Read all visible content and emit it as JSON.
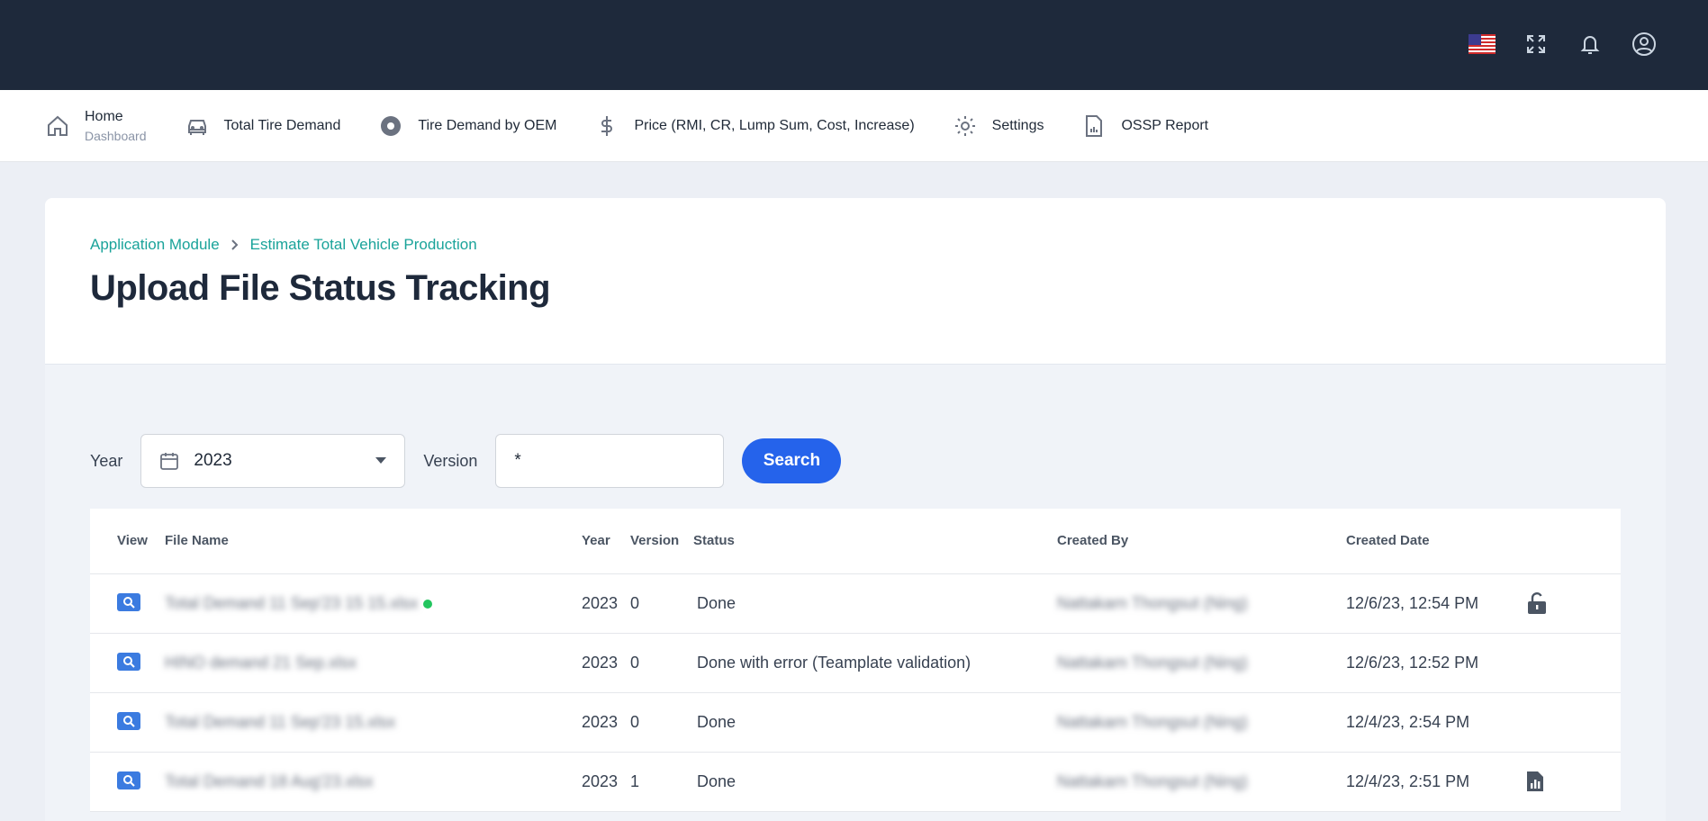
{
  "nav": {
    "items": [
      {
        "label": "Home",
        "sub": "Dashboard"
      },
      {
        "label": "Total Tire Demand"
      },
      {
        "label": "Tire Demand by OEM"
      },
      {
        "label": "Price (RMI, CR, Lump Sum, Cost, Increase)"
      },
      {
        "label": "Settings"
      },
      {
        "label": "OSSP Report"
      }
    ]
  },
  "breadcrumb": [
    "Application Module",
    "Estimate Total Vehicle Production"
  ],
  "page_title": "Upload File Status Tracking",
  "filters": {
    "year_label": "Year",
    "year_value": "2023",
    "version_label": "Version",
    "version_value": "*",
    "search_label": "Search"
  },
  "table": {
    "headers": [
      "View",
      "File Name",
      "Year",
      "Version",
      "Status",
      "Created By",
      "Created Date"
    ],
    "rows": [
      {
        "file": "Total Demand 11 Sep'23 15 15.xlsx",
        "year": "2023",
        "version": "0",
        "status": "Done",
        "created_by": "Nattakarn Thongsut (Ning)",
        "date": "12/6/23, 12:54 PM",
        "action": "unlock-icon"
      },
      {
        "file": "HINO demand 21 Sep.xlsx",
        "year": "2023",
        "version": "0",
        "status": "Done with error (Teamplate validation)",
        "created_by": "Nattakarn Thongsut (Ning)",
        "date": "12/6/23, 12:52 PM",
        "action": ""
      },
      {
        "file": "Total Demand 11 Sep'23 15.xlsx",
        "year": "2023",
        "version": "0",
        "status": "Done",
        "created_by": "Nattakarn Thongsut (Ning)",
        "date": "12/4/23, 2:54 PM",
        "action": ""
      },
      {
        "file": "Total Demand 18 Aug'23.xlsx",
        "year": "2023",
        "version": "1",
        "status": "Done",
        "created_by": "Nattakarn Thongsut (Ning)",
        "date": "12/4/23, 2:51 PM",
        "action": "report-icon"
      }
    ]
  },
  "colors": {
    "topbar": "#1e293b",
    "accent": "#2563eb",
    "breadcrumb": "#1aa39a"
  }
}
